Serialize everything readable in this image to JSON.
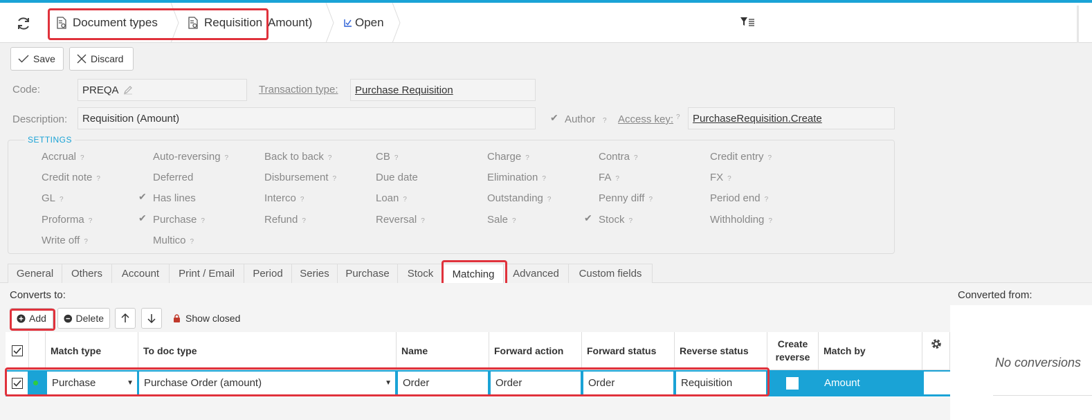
{
  "header": {
    "breadcrumbs": [
      {
        "label": "Document types"
      },
      {
        "label": "Requisition"
      },
      {
        "label": "Amount)"
      },
      {
        "label": "Open"
      }
    ]
  },
  "toolbar": {
    "save_label": "Save",
    "discard_label": "Discard"
  },
  "form": {
    "code_label": "Code:",
    "code_value": "PREQA",
    "transaction_type_label": "Transaction type:",
    "transaction_type_value": "Purchase Requisition",
    "description_label": "Description:",
    "description_value": "Requisition (Amount)",
    "author_label": "Author",
    "access_key_label": "Access key:",
    "access_key_value": "PurchaseRequisition.Create"
  },
  "settings": {
    "title": "SETTINGS",
    "options": [
      {
        "label": "Accrual",
        "help": true,
        "checked": false
      },
      {
        "label": "Auto-reversing",
        "help": true,
        "checked": false
      },
      {
        "label": "Back to back",
        "help": true,
        "checked": false
      },
      {
        "label": "CB",
        "help": true,
        "checked": false
      },
      {
        "label": "Charge",
        "help": true,
        "checked": false
      },
      {
        "label": "Contra",
        "help": true,
        "checked": false
      },
      {
        "label": "Credit entry",
        "help": true,
        "checked": false
      },
      {
        "label": "Credit note",
        "help": true,
        "checked": false
      },
      {
        "label": "Deferred",
        "help": false,
        "checked": false
      },
      {
        "label": "Disbursement",
        "help": true,
        "checked": false
      },
      {
        "label": "Due date",
        "help": false,
        "checked": false
      },
      {
        "label": "Elimination",
        "help": true,
        "checked": false
      },
      {
        "label": "FA",
        "help": true,
        "checked": false
      },
      {
        "label": "FX",
        "help": true,
        "checked": false
      },
      {
        "label": "GL",
        "help": true,
        "checked": false
      },
      {
        "label": "Has lines",
        "help": false,
        "checked": true
      },
      {
        "label": "Interco",
        "help": true,
        "checked": false
      },
      {
        "label": "Loan",
        "help": true,
        "checked": false
      },
      {
        "label": "Outstanding",
        "help": true,
        "checked": false
      },
      {
        "label": "Penny diff",
        "help": true,
        "checked": false
      },
      {
        "label": "Period end",
        "help": true,
        "checked": false
      },
      {
        "label": "Proforma",
        "help": true,
        "checked": false
      },
      {
        "label": "Purchase",
        "help": true,
        "checked": true
      },
      {
        "label": "Refund",
        "help": true,
        "checked": false
      },
      {
        "label": "Reversal",
        "help": true,
        "checked": false
      },
      {
        "label": "Sale",
        "help": true,
        "checked": false
      },
      {
        "label": "Stock",
        "help": true,
        "checked": true
      },
      {
        "label": "Withholding",
        "help": true,
        "checked": false
      },
      {
        "label": "Write off",
        "help": true,
        "checked": false
      },
      {
        "label": "Multico",
        "help": true,
        "checked": false
      }
    ],
    "help_glyph": "?"
  },
  "tabs": [
    {
      "label": "General"
    },
    {
      "label": "Others"
    },
    {
      "label": "Account"
    },
    {
      "label": "Print / Email"
    },
    {
      "label": "Period"
    },
    {
      "label": "Series"
    },
    {
      "label": "Purchase"
    },
    {
      "label": "Stock"
    },
    {
      "label": "Matching",
      "active": true
    },
    {
      "label": "Advanced"
    },
    {
      "label": "Custom fields"
    }
  ],
  "matching": {
    "converts_to_label": "Converts to:",
    "add_label": "Add",
    "delete_label": "Delete",
    "show_closed_label": "Show closed",
    "columns": [
      "Match type",
      "To doc type",
      "Name",
      "Forward action",
      "Forward status",
      "Reverse status",
      "Create reverse",
      "Match by"
    ],
    "row": {
      "match_type": "Purchase",
      "to_doc_type": "Purchase Order (amount)",
      "name": "Order",
      "forward_action": "Order",
      "forward_status": "Order",
      "reverse_status": "Requisition",
      "create_reverse": false,
      "match_by": "Amount"
    },
    "converted_from_label": "Converted from:",
    "no_conversions_text": "No conversions"
  },
  "colors": {
    "accent": "#1aa3d6",
    "highlight": "#e0323c",
    "status_dot": "#2ecc40"
  }
}
